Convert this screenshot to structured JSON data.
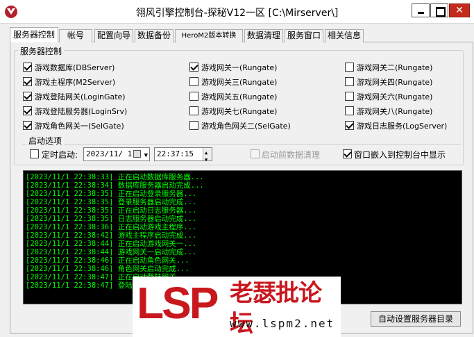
{
  "window": {
    "title": "翎风引擎控制台-探秘V12一区 [C:\\Mirserver\\]"
  },
  "tabs": [
    "服务器控制",
    "帐号",
    "配置向导",
    "数据备份",
    "HeroM2版本转换",
    "数据清理",
    "服务窗口",
    "相关信息"
  ],
  "server_control": {
    "group_title": "服务器控制",
    "items": [
      {
        "label": "游戏数据库(DBServer)",
        "checked": true
      },
      {
        "label": "游戏网关一(Rungate)",
        "checked": true
      },
      {
        "label": "游戏网关二(Rungate)",
        "checked": false
      },
      {
        "label": "游戏主程序(M2Server)",
        "checked": true
      },
      {
        "label": "游戏网关三(Rungate)",
        "checked": false
      },
      {
        "label": "游戏网关四(Rungate)",
        "checked": false
      },
      {
        "label": "游戏登陆网关(LoginGate)",
        "checked": true
      },
      {
        "label": "游戏网关五(Rungate)",
        "checked": false
      },
      {
        "label": "游戏网关六(Rungate)",
        "checked": false
      },
      {
        "label": "游戏登陆服务器(LoginSrv)",
        "checked": true
      },
      {
        "label": "游戏网关七(Rungate)",
        "checked": false
      },
      {
        "label": "游戏网关八(Rungate)",
        "checked": false
      },
      {
        "label": "游戏角色网关一(SelGate)",
        "checked": true
      },
      {
        "label": "游戏角色网关二(SelGate)",
        "checked": false
      },
      {
        "label": "游戏日志服务(LogServer)",
        "checked": true
      }
    ]
  },
  "start_options": {
    "title": "启动选项",
    "timed_start_label": "定时启动:",
    "timed_start_checked": false,
    "date_value": "2023/11/ 1",
    "time_value": "22:37:15",
    "clean_before_start_label": "启动前数据清理",
    "clean_before_start_checked": false,
    "embed_window_label": "窗口嵌入到控制台中显示",
    "embed_window_checked": true
  },
  "console": {
    "lines": [
      "[2023/11/1 22:38:33] 正在启动数据库服务器...",
      "[2023/11/1 22:38:34] 数据库服务器启动完成...",
      "[2023/11/1 22:38:35] 正在启动登录服务器...",
      "[2023/11/1 22:38:35] 登录服务器启动完成...",
      "[2023/11/1 22:38:35] 正在启动日志服务器...",
      "[2023/11/1 22:38:35] 日志服务器启动完成...",
      "[2023/11/1 22:38:36] 正在启动游戏主程序...",
      "[2023/11/1 22:38:42] 游戏主程序启动完成...",
      "[2023/11/1 22:38:44] 正在启动游戏网关一...",
      "[2023/11/1 22:38:44] 游戏网关一启动完成...",
      "[2023/11/1 22:38:46] 正在启动角色网关...",
      "[2023/11/1 22:38:46] 角色网关启动完成...",
      "[2023/11/1 22:38:47] 正在启动登陆网关...",
      "[2023/11/1 22:38:47] 登陆网关启动完成..."
    ]
  },
  "watermark": {
    "brand": "LSP",
    "name": "老瑟批论坛",
    "url": "www.lspm2.net"
  },
  "buttons": {
    "set_server_dir": "自动设置服务器目录"
  },
  "colors": {
    "console_text": "#00ff00",
    "console_bg": "#000000",
    "watermark_red": "#c9171e"
  }
}
